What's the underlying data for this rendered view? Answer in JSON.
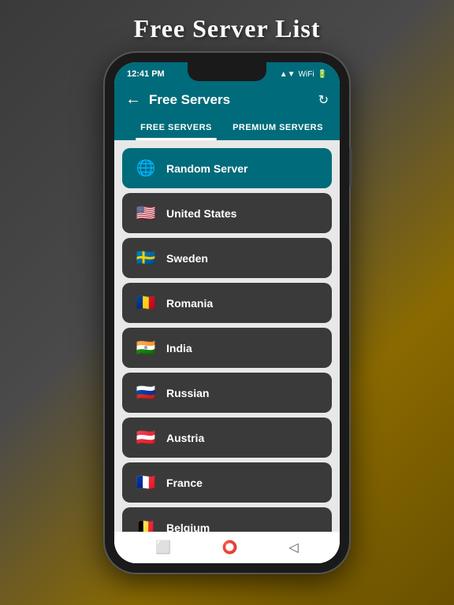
{
  "page": {
    "title": "Free Server List",
    "background_colors": [
      "#3a3a3a",
      "#8a6a00"
    ]
  },
  "status_bar": {
    "time": "12:41 PM",
    "signal": "▲▼",
    "battery": "■"
  },
  "header": {
    "title": "Free Servers",
    "back_label": "←",
    "refresh_label": "↻"
  },
  "tabs": [
    {
      "label": "FREE SERVERS",
      "active": true
    },
    {
      "label": "PREMIUM SERVERS",
      "active": false
    }
  ],
  "servers": [
    {
      "name": "Random Server",
      "flag": "🌐",
      "type": "random"
    },
    {
      "name": "United States",
      "flag": "🇺🇸",
      "type": "country"
    },
    {
      "name": "Sweden",
      "flag": "🇸🇪",
      "type": "country"
    },
    {
      "name": "Romania",
      "flag": "🇷🇴",
      "type": "country"
    },
    {
      "name": "India",
      "flag": "🇮🇳",
      "type": "country"
    },
    {
      "name": "Russian",
      "flag": "🇷🇺",
      "type": "country"
    },
    {
      "name": "Austria",
      "flag": "🇦🇹",
      "type": "country"
    },
    {
      "name": "France",
      "flag": "🇫🇷",
      "type": "country"
    },
    {
      "name": "Belgium",
      "flag": "🇧🇪",
      "type": "country"
    }
  ],
  "bottom_nav": {
    "icons": [
      "square",
      "circle",
      "triangle"
    ]
  }
}
